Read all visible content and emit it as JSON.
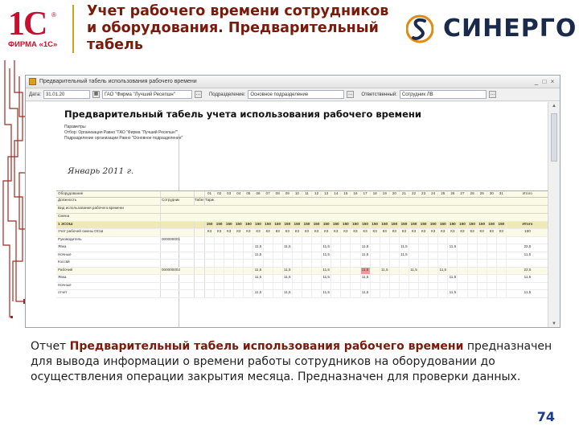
{
  "slide": {
    "title": "Учет рабочего времени сотрудников и оборудования. Предварительный табель",
    "logo_1c": "1С",
    "logo_1c_firm": "ФИРМА «1С»",
    "logo_sinergo": "СИНЕРГО",
    "page_number": "74",
    "colors": {
      "title": "#7a1a0a",
      "brand_red": "#c8102e",
      "highlight": "#f29a9a"
    }
  },
  "window": {
    "title": "Предварительный табель использования рабочего времени",
    "toolbar": {
      "date_label": "Дата:",
      "date_value": "31.01.20",
      "org_value": "ГАО \"Фирма \"Лучший Ресепшн\"",
      "period_label": "Подразделение:",
      "dept_value": "Основное подразделение",
      "responsible_label": "Ответственный:",
      "responsible_value": "Сотрудник ЛВ"
    }
  },
  "report": {
    "title": "Предварительный табель учета использования рабочего времени",
    "period": "Январь 2011 г.",
    "meta_lines": [
      "Параметры",
      "Отбор:       Организация Равно \"ГАО \"Фирма \"Лучший Ресепшн\"\"",
      "                 Подразделение организации Равно \"Основное подразделение\""
    ],
    "grid": {
      "col_group": "Оборудование",
      "sub_headers": [
        "Должность",
        "Сотрудник",
        "Табельный номер",
        "Тариф",
        "Вид использования рабочего времени"
      ],
      "section_labels": [
        "Смена",
        "1 ЭСОШ"
      ],
      "days": [
        "01",
        "02",
        "03",
        "04",
        "05",
        "06",
        "07",
        "08",
        "09",
        "10",
        "11",
        "12",
        "13",
        "14",
        "15",
        "16",
        "17",
        "18",
        "19",
        "20",
        "21",
        "22",
        "23",
        "24",
        "25",
        "26",
        "27",
        "28",
        "29",
        "30",
        "31"
      ],
      "total_label": "Итого",
      "total_cells": [
        "150",
        "150",
        "150",
        "150",
        "150",
        "150",
        "150",
        "150",
        "150",
        "150",
        "150",
        "150",
        "150",
        "150",
        "150",
        "150",
        "150",
        "150",
        "150",
        "150",
        "150",
        "150",
        "150",
        "150",
        "150",
        "150",
        "150",
        "150",
        "150",
        "150",
        "150"
      ],
      "rows": [
        {
          "label": "Учет рабочей смены ОСШ",
          "code": "",
          "cells": [
            "К3",
            "К3",
            "К3",
            "К3",
            "К3",
            "К3",
            "К3",
            "К3",
            "К3",
            "К3",
            "К3",
            "К3",
            "К3",
            "К3",
            "К3",
            "К3",
            "К3",
            "К3",
            "К3",
            "К3",
            "К3",
            "К3",
            "К3",
            "К3",
            "К3",
            "К3",
            "К3",
            "К3",
            "К3",
            "К3",
            "К3"
          ],
          "total": "150",
          "group": true
        },
        {
          "label": "Руководитель",
          "code": "000000001",
          "cells": [
            "",
            "",
            "",
            "",
            "",
            "",
            "",
            "",
            "",
            "",
            "",
            "",
            "",
            "",
            "",
            "",
            "",
            "",
            "",
            "",
            "",
            "",
            "",
            "",
            "",
            "",
            "",
            "",
            "",
            "",
            ""
          ],
          "total": "",
          "group": false
        },
        {
          "label": "Явка",
          "code": "",
          "cells": [
            "",
            "",
            "",
            "",
            "",
            "11,5",
            "",
            "",
            "11,5",
            "",
            "",
            "",
            "11,5",
            "",
            "",
            "",
            "11,5",
            "",
            "",
            "",
            "11,5",
            "",
            "",
            "",
            "",
            "11,5",
            "",
            "",
            "",
            "",
            ""
          ],
          "total": "22,5",
          "group": false
        },
        {
          "label": "Ночные",
          "code": "",
          "cells": [
            "",
            "",
            "",
            "",
            "",
            "11,5",
            "",
            "",
            "",
            "",
            "",
            "",
            "11,5",
            "",
            "",
            "",
            "11,5",
            "",
            "",
            "",
            "11,5",
            "",
            "",
            "",
            "",
            "",
            "",
            "",
            "",
            "",
            ""
          ],
          "total": "11,5",
          "group": false
        },
        {
          "label": "Кэссвй",
          "code": "",
          "cells": [
            "",
            "",
            "",
            "",
            "",
            "",
            "",
            "",
            "",
            "",
            "",
            "",
            "",
            "",
            "",
            "",
            "",
            "",
            "",
            "",
            "",
            "",
            "",
            "",
            "",
            "",
            "",
            "",
            "",
            "",
            ""
          ],
          "total": "",
          "group": false
        },
        {
          "label": "Рабочий",
          "code": "000000002",
          "cells": [
            "",
            "",
            "",
            "",
            "",
            "11,5",
            "",
            "",
            "11,5",
            "",
            "",
            "",
            "11,5",
            "",
            "",
            "",
            "11,5",
            "",
            "11,5",
            "",
            "",
            "11,5",
            "",
            "",
            "11,5",
            "",
            "",
            "",
            "",
            "",
            ""
          ],
          "total": "22,5",
          "group": true,
          "highlight_index": 16
        },
        {
          "label": "Явка",
          "code": "",
          "cells": [
            "",
            "",
            "",
            "",
            "",
            "11,5",
            "",
            "",
            "11,5",
            "",
            "",
            "",
            "11,5",
            "",
            "",
            "",
            "11,5",
            "",
            "",
            "",
            "",
            "",
            "",
            "",
            "",
            "11,5",
            "",
            "",
            "",
            "",
            ""
          ],
          "total": "11,5",
          "group": false
        },
        {
          "label": "Ночные",
          "code": "",
          "cells": [
            "",
            "",
            "",
            "",
            "",
            "",
            "",
            "",
            "",
            "",
            "",
            "",
            "",
            "",
            "",
            "",
            "",
            "",
            "",
            "",
            "",
            "",
            "",
            "",
            "",
            "",
            "",
            "",
            "",
            "",
            ""
          ],
          "total": "",
          "group": false
        },
        {
          "label": "отчет",
          "code": "",
          "cells": [
            "",
            "",
            "",
            "",
            "",
            "11,5",
            "",
            "",
            "11,5",
            "",
            "",
            "",
            "11,5",
            "",
            "",
            "",
            "11,5",
            "",
            "",
            "",
            "",
            "",
            "",
            "",
            "",
            "11,5",
            "",
            "",
            "",
            "",
            ""
          ],
          "total": "11,5",
          "group": false
        }
      ]
    }
  },
  "description": {
    "prefix": "Отчет ",
    "highlight": "Предварительный табель использования рабочего времени",
    "suffix": " предназначен для вывода информации о времени работы сотрудников на оборудовании до осуществления операции закрытия месяца. Предназначен для проверки данных."
  }
}
